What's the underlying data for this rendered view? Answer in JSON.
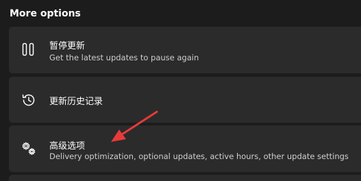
{
  "section": {
    "title": "More options"
  },
  "cards": [
    {
      "icon": "pause-icon",
      "title": "暂停更新",
      "subtitle": "Get the latest updates to pause again"
    },
    {
      "icon": "history-icon",
      "title": "更新历史记录"
    },
    {
      "icon": "gears-icon",
      "title": "高级选项",
      "subtitle": "Delivery optimization, optional updates, active hours, other update settings"
    }
  ],
  "colors": {
    "background": "#1c1c1c",
    "card": "#2b2b2b",
    "annotation_arrow": "#e83a3a"
  }
}
